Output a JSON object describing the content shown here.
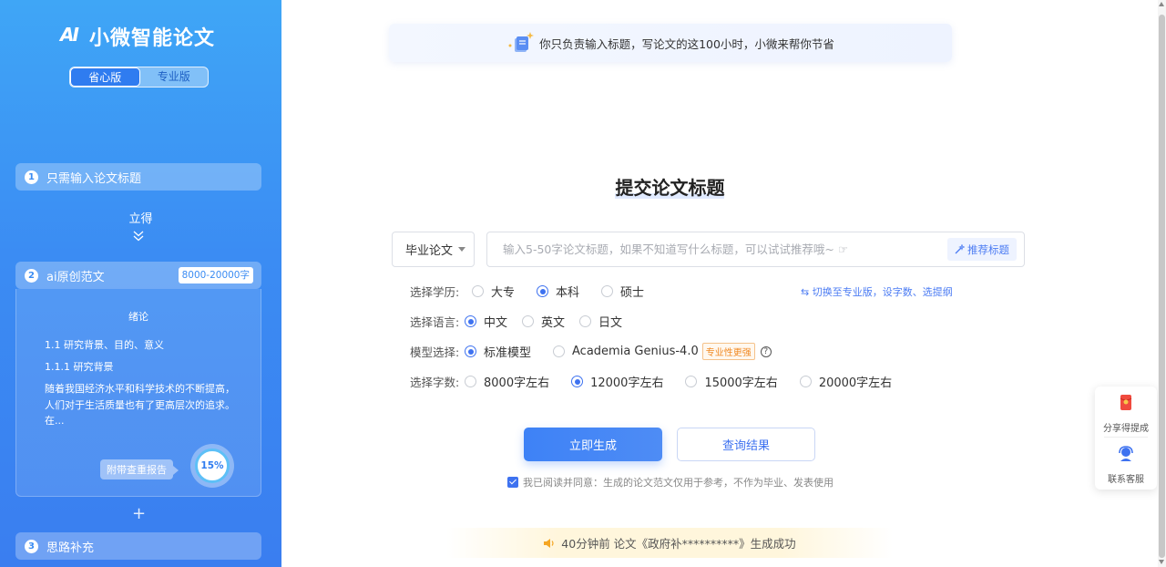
{
  "sidebar": {
    "brand": "小微智能论文",
    "logo_mark": "AI",
    "version_tabs": [
      {
        "label": "省心版",
        "active": true
      },
      {
        "label": "专业版",
        "active": false
      }
    ],
    "steps": [
      {
        "num": "1",
        "label": "只需输入论文标题"
      },
      {
        "num": "2",
        "label": "ai原创范文",
        "badge": "8000-20000字"
      },
      {
        "num": "3",
        "label": "思路补充"
      }
    ],
    "instant_label": "立得",
    "sample": {
      "title": "绪论",
      "line1": "1.1 研究背景、目的、意义",
      "line2": "1.1.1 研究背景",
      "paragraph": "随着我国经济水平和科学技术的不断提高，人们对于生活质量也有了更高层次的追求。在...",
      "report_tag": "附带查重报告",
      "percent": "15%"
    },
    "plus_symbol": "+"
  },
  "banner": {
    "text": "你只负责输入标题，写论文的这100小时，小微来帮你节省"
  },
  "form": {
    "title": "提交论文标题",
    "type_select": "毕业论文",
    "title_input": {
      "value": "",
      "placeholder": "输入5-50字论文标题，如果不知道写什么标题，可以试试推荐哦~ ☞"
    },
    "recommend_label": "推荐标题",
    "switch_link": "切换至专业版，设字数、选提纲",
    "education": {
      "label": "选择学历:",
      "options": [
        "大专",
        "本科",
        "硕士"
      ],
      "selected": "本科"
    },
    "language": {
      "label": "选择语言:",
      "options": [
        "中文",
        "英文",
        "日文"
      ],
      "selected": "中文"
    },
    "model": {
      "label": "模型选择:",
      "options": [
        "标准模型",
        "Academia Genius-4.0"
      ],
      "selected": "标准模型",
      "pro_badge": "专业性更强",
      "help": "?"
    },
    "words": {
      "label": "选择字数:",
      "options": [
        "8000字左右",
        "12000字左右",
        "15000字左右",
        "20000字左右"
      ],
      "selected": "12000字左右"
    },
    "generate_label": "立即生成",
    "query_label": "查询结果",
    "agreement": "我已阅读并同意：生成的论文范文仅用于参考，不作为毕业、发表使用",
    "agreement_checked": true
  },
  "notice": {
    "text": "40分钟前  论文《政府补**********》生成成功"
  },
  "float_panel": {
    "share_label": "分享得提成",
    "service_label": "联系客服"
  },
  "colors": {
    "accent": "#3e72f0",
    "sidebar_top": "#3fa6f6",
    "sidebar_bottom": "#3a7ef0",
    "badge_orange": "#f08a24"
  }
}
